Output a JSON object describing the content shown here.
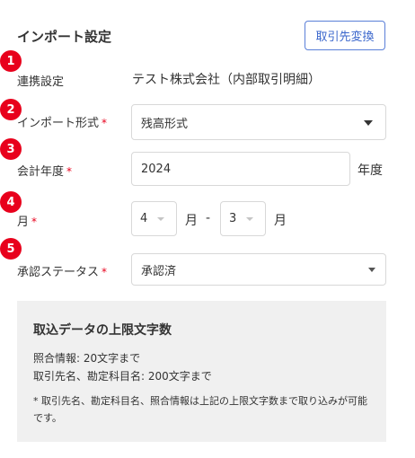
{
  "header": {
    "title": "インポート設定",
    "switch_button": "取引先変換"
  },
  "badges": [
    "1",
    "2",
    "3",
    "4",
    "5"
  ],
  "fields": {
    "link": {
      "label": "連携設定",
      "value": "テスト株式会社（内部取引明細）"
    },
    "import_format": {
      "label": "インポート形式",
      "required": "*",
      "value": "残高形式"
    },
    "fiscal_year": {
      "label": "会計年度",
      "required": "*",
      "value": "2024",
      "suffix": "年度"
    },
    "month": {
      "label": "月",
      "required": "*",
      "from": "4",
      "from_unit": "月",
      "separator": "-",
      "to": "3",
      "to_unit": "月"
    },
    "approval_status": {
      "label": "承認ステータス",
      "required": "*",
      "value": "承認済"
    }
  },
  "info": {
    "title": "取込データの上限文字数",
    "line1": "照合情報: 20文字まで",
    "line2": "取引先名、勘定科目名: 200文字まで",
    "note": "* 取引先名、勘定科目名、照合情報は上記の上限文字数まで取り込みが可能です。"
  },
  "colors": {
    "accent": "#3a66cc",
    "badge": "#e8001c",
    "required": "#e8001c",
    "info_bg": "#f0f0f0"
  }
}
